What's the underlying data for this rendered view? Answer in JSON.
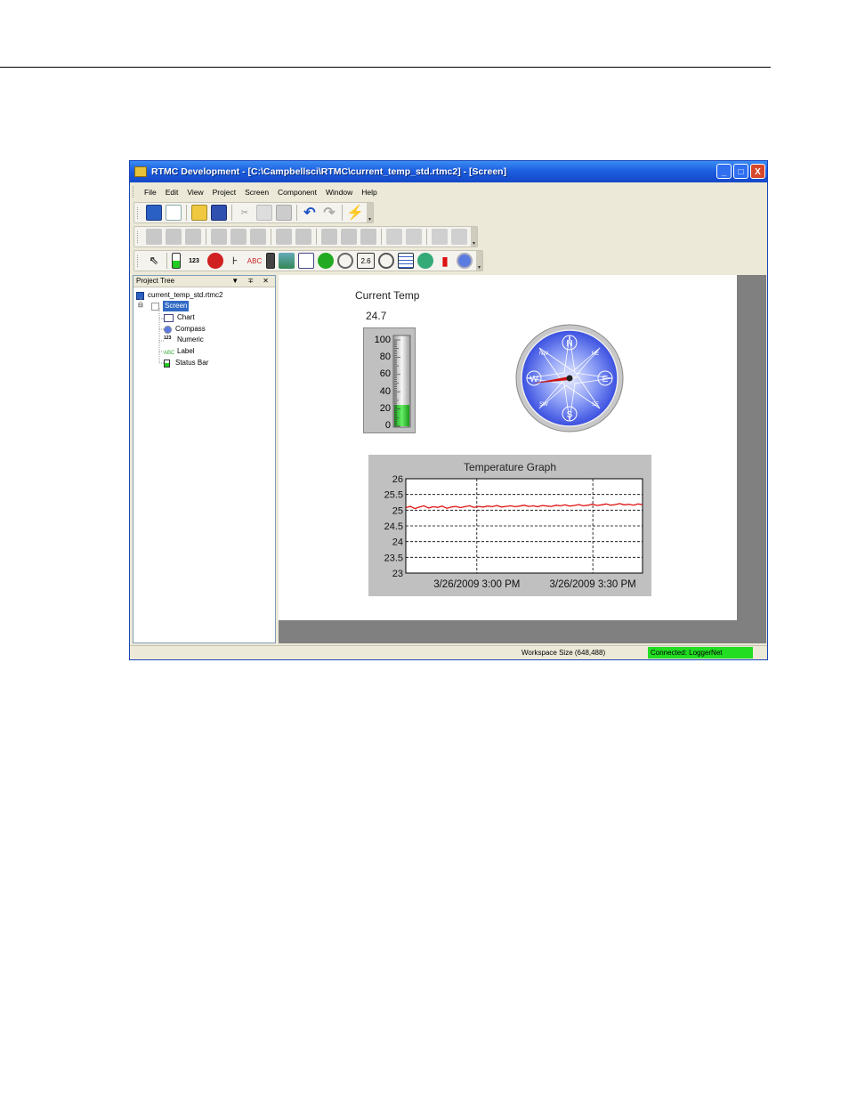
{
  "window": {
    "title": "RTMC Development - [C:\\Campbellsci\\RTMC\\current_temp_std.rtmc2] - [Screen]",
    "buttons": [
      "_",
      "□",
      "X"
    ]
  },
  "menu": [
    "File",
    "Edit",
    "View",
    "Project",
    "Screen",
    "Component",
    "Window",
    "Help"
  ],
  "project_tree": {
    "header": "Project Tree",
    "header_buttons": "▼ ∓ ✕",
    "root": "current_temp_std.rtmc2",
    "screen": "Screen",
    "components": [
      "Chart",
      "Compass",
      "Numeric",
      "Label",
      "Status Bar"
    ]
  },
  "canvas": {
    "current_temp": {
      "title": "Current Temp",
      "value": "24.7",
      "scale": [
        "100",
        "80",
        "60",
        "40",
        "20",
        "0"
      ],
      "level": 24.7,
      "max": 100
    },
    "compass": {
      "labels": [
        "N",
        "E",
        "S",
        "W",
        "NE",
        "SE",
        "SW",
        "NW"
      ],
      "heading_deg": 262
    }
  },
  "toolbar": {
    "numeric_tile": "2.6"
  },
  "status": {
    "workspace": "Workspace Size (648,488)",
    "connection": "Connected: LoggerNet",
    "connection_color": "#22dd22"
  },
  "chart_data": {
    "type": "line",
    "title": "Temperature Graph",
    "ylim": [
      23,
      26
    ],
    "y_ticks": [
      "26",
      "25.5",
      "25",
      "24.5",
      "24",
      "23.5",
      "23"
    ],
    "x_ticks": [
      "3/26/2009 3:00 PM",
      "3/26/2009 3:30 PM"
    ],
    "line_color": "#e01010",
    "series": [
      {
        "values": [
          25.08,
          25.12,
          25.05,
          25.1,
          25.14,
          25.07,
          25.11,
          25.09,
          25.13,
          25.06,
          25.1,
          25.12,
          25.08,
          25.11,
          25.14,
          25.09,
          25.12,
          25.1,
          25.13,
          25.11,
          25.15,
          25.1,
          25.12,
          25.14,
          25.11,
          25.13,
          25.16,
          25.12,
          25.14,
          25.11,
          25.15,
          25.13,
          25.12,
          25.16,
          25.14,
          25.17,
          25.13,
          25.15,
          25.18,
          25.14,
          25.16,
          25.19,
          25.15,
          25.17,
          25.2,
          25.16,
          25.18,
          25.21,
          25.17,
          25.19,
          25.16,
          25.2,
          25.18
        ]
      }
    ]
  }
}
